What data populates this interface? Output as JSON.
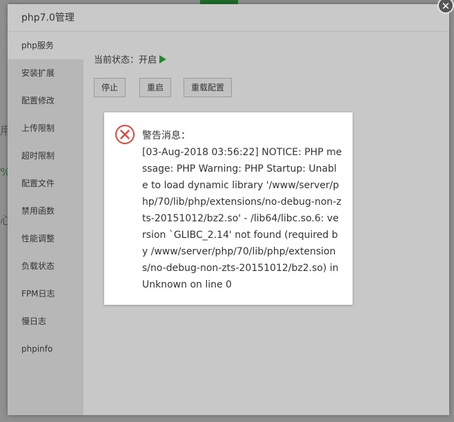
{
  "modal": {
    "title": "php7.0管理",
    "close_symbol": "✕"
  },
  "sidebar": {
    "items": [
      {
        "label": "php服务"
      },
      {
        "label": "安装扩展"
      },
      {
        "label": "配置修改"
      },
      {
        "label": "上传限制"
      },
      {
        "label": "超时限制"
      },
      {
        "label": "配置文件"
      },
      {
        "label": "禁用函数"
      },
      {
        "label": "性能调整"
      },
      {
        "label": "负载状态"
      },
      {
        "label": "FPM日志"
      },
      {
        "label": "慢日志"
      },
      {
        "label": "phpinfo"
      }
    ]
  },
  "service": {
    "status_label": "当前状态：开启",
    "stop_label": "停止",
    "restart_label": "重启",
    "reload_label": "重载配置"
  },
  "alert": {
    "title": "警告消息：",
    "message": "[03-Aug-2018 03:56:22] NOTICE: PHP message: PHP Warning: PHP Startup: Unable to load dynamic library '/www/server/php/70/lib/php/extensions/no-debug-non-zts-20151012/bz2.so' - /lib64/libc.so.6: version `GLIBC_2.14' not found (required by /www/server/php/70/lib/php/extensions/no-debug-non-zts-20151012/bz2.so) in Unknown on line 0"
  },
  "background": {
    "fragments": [
      "用",
      "%",
      "心"
    ]
  },
  "colors": {
    "accent_green": "#1e8a2c",
    "error_red": "#e0473c"
  }
}
